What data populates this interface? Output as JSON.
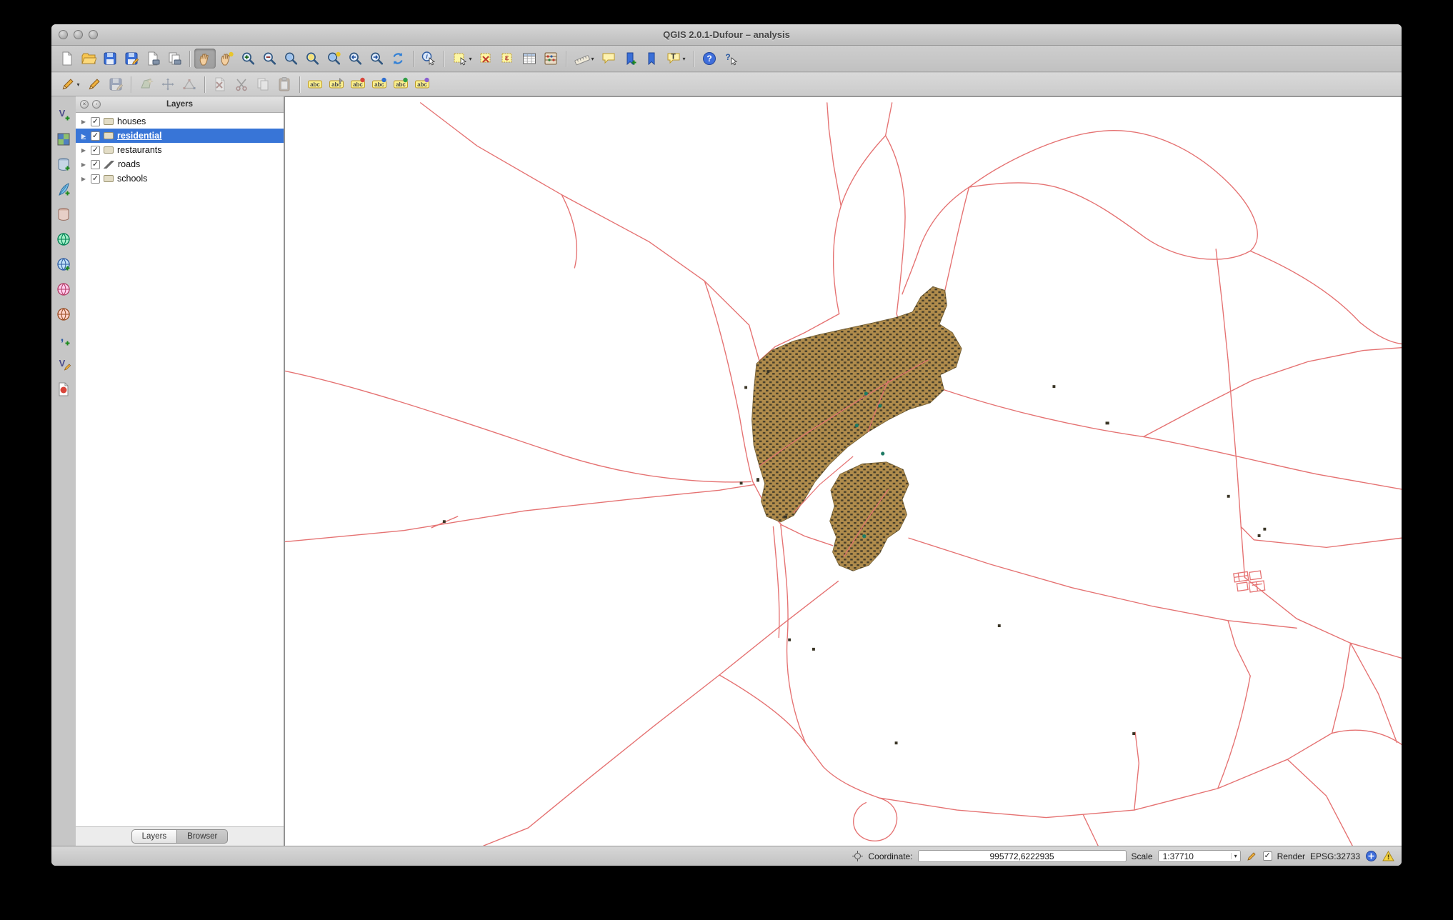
{
  "window": {
    "title": "QGIS 2.0.1-Dufour – analysis"
  },
  "glyphs": {
    "check": "✓",
    "dropdown": "▾",
    "expand": "▶",
    "info_i": "i",
    "epsilon": "ε",
    "abc": "abc",
    "text_t": "T",
    "question": "?",
    "vector_v": "V",
    "comma": ","
  },
  "toolbar": {
    "row1_icons": [
      "new-project",
      "open-project",
      "save-project",
      "save-project-as",
      "new-print-composer",
      "composer-manager",
      "pan-map",
      "pan-to-selection",
      "zoom-in",
      "zoom-out",
      "zoom-full",
      "zoom-to-selection",
      "zoom-to-layer",
      "zoom-last",
      "zoom-next",
      "refresh-map",
      "identify-features",
      "select-features",
      "deselect-features",
      "select-by-expression",
      "open-attribute-table",
      "field-calculator",
      "measure-line",
      "map-tips",
      "new-bookmark",
      "show-bookmarks",
      "text-annotation",
      "help-contents",
      "whats-this"
    ],
    "row2_icons": [
      "current-edits",
      "toggle-editing",
      "save-layer-edits",
      "add-feature",
      "move-feature",
      "node-tool",
      "delete-selected",
      "cut-features",
      "copy-features",
      "paste-features",
      "labeling",
      "label-pin",
      "label-show-hide",
      "label-move",
      "label-rotate",
      "label-properties"
    ],
    "left_icons": [
      "add-vector-layer",
      "add-raster-layer",
      "add-postgis-layer",
      "add-spatialite-layer",
      "add-mssql-layer",
      "add-oracle-layer",
      "add-wms-layer",
      "add-wcs-layer",
      "add-wfs-layer",
      "add-delimited-text-layer",
      "new-shapefile-layer",
      "new-spatialite-layer"
    ]
  },
  "layers_panel": {
    "title": "Layers",
    "items": [
      {
        "name": "layer-item-houses",
        "label": "houses",
        "checked": "checked",
        "icon": "lyr-poly",
        "state": ""
      },
      {
        "name": "layer-item-residential",
        "label": "residential",
        "checked": "checked",
        "icon": "lyr-poly",
        "state": "selected"
      },
      {
        "name": "layer-item-restaurants",
        "label": "restaurants",
        "checked": "checked",
        "icon": "lyr-poly",
        "state": ""
      },
      {
        "name": "layer-item-roads",
        "label": "roads",
        "checked": "checked",
        "icon": "lyr-line",
        "state": ""
      },
      {
        "name": "layer-item-schools",
        "label": "schools",
        "checked": "checked",
        "icon": "lyr-poly",
        "state": ""
      }
    ],
    "tabs": [
      {
        "label": "Layers",
        "active": true
      },
      {
        "label": "Browser",
        "active": false
      }
    ]
  },
  "statusbar": {
    "coordinate_label": "Coordinate:",
    "coordinate_value": "995772,6222935",
    "scale_label": "Scale",
    "scale_value": "1:37710",
    "render_label": "Render",
    "crs": "EPSG:32733"
  },
  "colors": {
    "roads": "#e57272",
    "residential": "#b08c4c",
    "buildings": "#3a3526",
    "poi": "#1e7a64",
    "selection": "#3875d7",
    "canvas": "#ffffff"
  }
}
